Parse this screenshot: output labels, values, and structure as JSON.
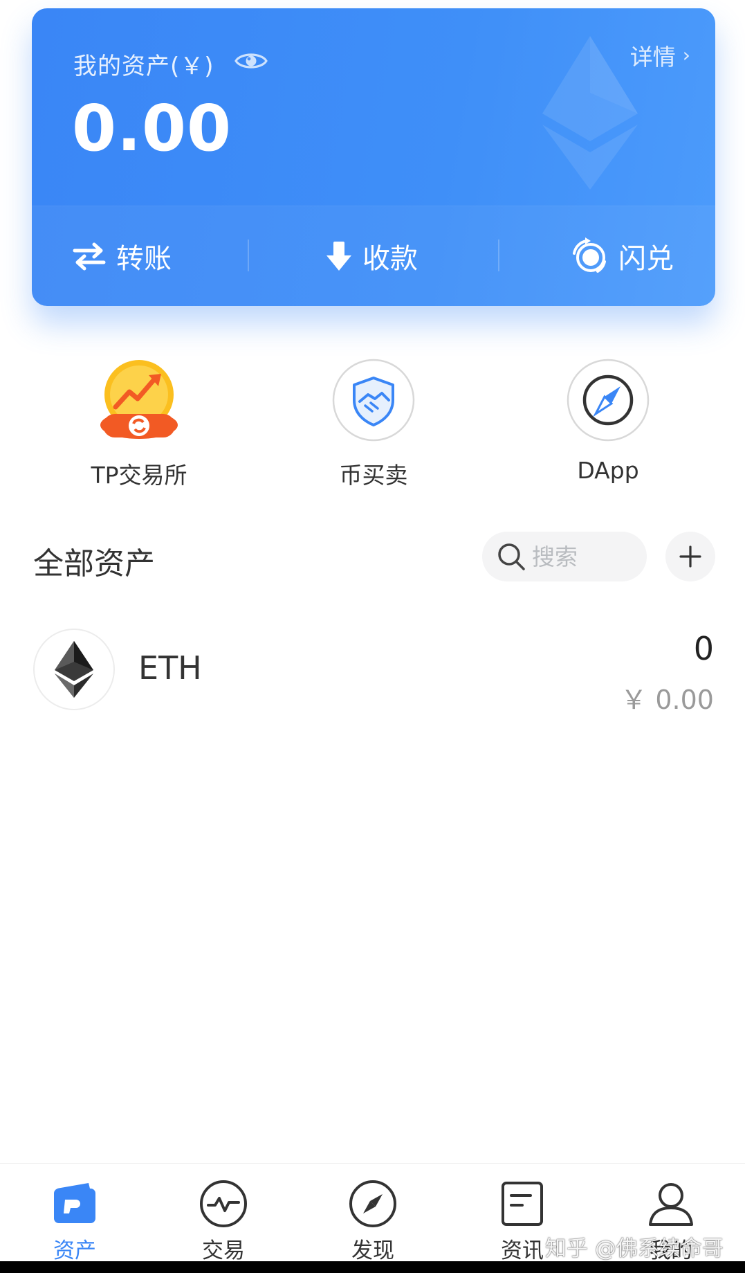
{
  "asset_card": {
    "label": "我的资产(￥)",
    "detail_label": "详情",
    "balance": "0.00",
    "actions": [
      {
        "label": "转账",
        "icon": "transfer-arrows-icon"
      },
      {
        "label": "收款",
        "icon": "download-arrow-icon"
      },
      {
        "label": "闪兑",
        "icon": "flash-swap-icon"
      }
    ]
  },
  "shortcuts": [
    {
      "label": "TP交易所",
      "icon": "tp-exchange-icon"
    },
    {
      "label": "币买卖",
      "icon": "shield-handshake-icon"
    },
    {
      "label": "DApp",
      "icon": "compass-icon"
    }
  ],
  "assets_section": {
    "title": "全部资产",
    "search_placeholder": "搜索"
  },
  "assets": [
    {
      "symbol": "ETH",
      "amount": "0",
      "fiat_value": "￥ 0.00",
      "icon": "ethereum-icon"
    }
  ],
  "bottom_nav": [
    {
      "label": "资产",
      "icon": "wallet-icon",
      "active": true
    },
    {
      "label": "交易",
      "icon": "trade-wave-icon",
      "active": false
    },
    {
      "label": "发现",
      "icon": "compass-icon",
      "active": false
    },
    {
      "label": "资讯",
      "icon": "news-icon",
      "active": false
    },
    {
      "label": "我的",
      "icon": "user-icon",
      "active": false
    }
  ],
  "watermark": "知乎 @佛系续命哥",
  "colors": {
    "accent": "#3a86f6",
    "card_gradient_end": "#4c9bfb",
    "tp_orange": "#f25a24",
    "tp_gold": "#fbbf1f"
  }
}
